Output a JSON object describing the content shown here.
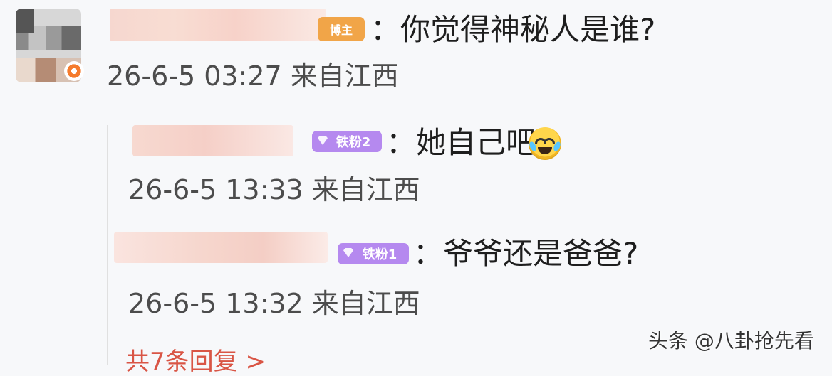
{
  "comment": {
    "badge_label": "博主",
    "text": "：你觉得神秘人是谁?",
    "meta": "26-6-5 03:27 来自江西"
  },
  "replies": [
    {
      "badge_label": "铁粉2",
      "text": "：她自己吧",
      "meta": "26-6-5 13:33 来自江西",
      "emoji": "laugh-cry-emoji"
    },
    {
      "badge_label": "铁粉1",
      "text": "：爷爷还是爸爸?",
      "meta": "26-6-5 13:32 来自江西"
    }
  ],
  "more_replies_label": "共7条回复 >",
  "watermark": "头条 @八卦抢先看",
  "colors": {
    "background": "#f7f8fa",
    "text": "#1e1e1e",
    "meta": "#4c4c4c",
    "reply_link": "#d95545",
    "blogger_badge": "#f1a548",
    "fan_badge": "#b589ef"
  }
}
